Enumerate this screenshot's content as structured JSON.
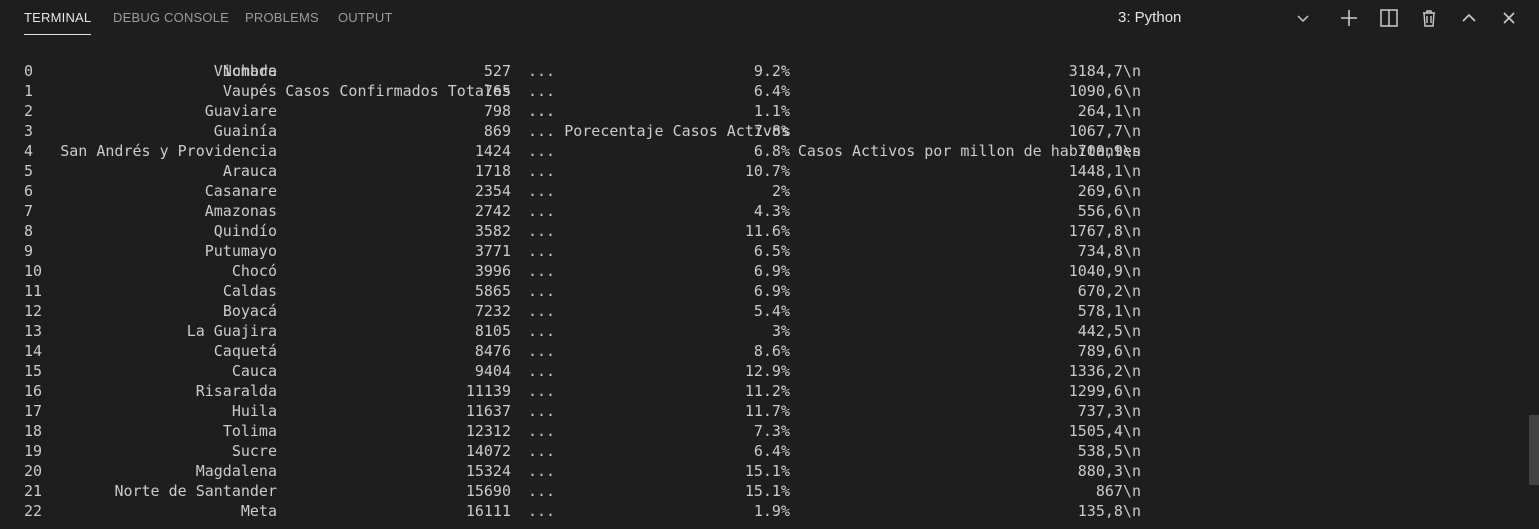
{
  "tabs": [
    {
      "label": "TERMINAL",
      "active": true
    },
    {
      "label": "DEBUG CONSOLE",
      "active": false
    },
    {
      "label": "PROBLEMS",
      "active": false
    },
    {
      "label": "OUTPUT",
      "active": false
    }
  ],
  "terminal_select": {
    "value": "3: Python"
  },
  "toolbar_icons": [
    "chevron-down-icon",
    "add-icon",
    "split-icon",
    "trash-icon",
    "chevron-up-icon",
    "close-icon"
  ],
  "table": {
    "headers": {
      "name": "Nombre",
      "confirmed": "Casos Confirmados Totales",
      "ellipsis": "...",
      "pct_active": "Porecentaje Casos Activos",
      "active_per_million": "Casos Activos por millon de habitantes"
    },
    "rows": [
      {
        "idx": "0",
        "name": "Vichada",
        "confirmed": "527",
        "ellipsis": "...",
        "pct": "9.2%",
        "apm": "3184,7\\n"
      },
      {
        "idx": "1",
        "name": "Vaupés",
        "confirmed": "765",
        "ellipsis": "...",
        "pct": "6.4%",
        "apm": "1090,6\\n"
      },
      {
        "idx": "2",
        "name": "Guaviare",
        "confirmed": "798",
        "ellipsis": "...",
        "pct": "1.1%",
        "apm": "264,1\\n"
      },
      {
        "idx": "3",
        "name": "Guainía",
        "confirmed": "869",
        "ellipsis": "...",
        "pct": "7.8%",
        "apm": "1067,7\\n"
      },
      {
        "idx": "4",
        "name": "San Andrés y Providencia",
        "confirmed": "1424",
        "ellipsis": "...",
        "pct": "6.8%",
        "apm": "700,9\\n"
      },
      {
        "idx": "5",
        "name": "Arauca",
        "confirmed": "1718",
        "ellipsis": "...",
        "pct": "10.7%",
        "apm": "1448,1\\n"
      },
      {
        "idx": "6",
        "name": "Casanare",
        "confirmed": "2354",
        "ellipsis": "...",
        "pct": "2%",
        "apm": "269,6\\n"
      },
      {
        "idx": "7",
        "name": "Amazonas",
        "confirmed": "2742",
        "ellipsis": "...",
        "pct": "4.3%",
        "apm": "556,6\\n"
      },
      {
        "idx": "8",
        "name": "Quindío",
        "confirmed": "3582",
        "ellipsis": "...",
        "pct": "11.6%",
        "apm": "1767,8\\n"
      },
      {
        "idx": "9",
        "name": "Putumayo",
        "confirmed": "3771",
        "ellipsis": "...",
        "pct": "6.5%",
        "apm": "734,8\\n"
      },
      {
        "idx": "10",
        "name": "Chocó",
        "confirmed": "3996",
        "ellipsis": "...",
        "pct": "6.9%",
        "apm": "1040,9\\n"
      },
      {
        "idx": "11",
        "name": "Caldas",
        "confirmed": "5865",
        "ellipsis": "...",
        "pct": "6.9%",
        "apm": "670,2\\n"
      },
      {
        "idx": "12",
        "name": "Boyacá",
        "confirmed": "7232",
        "ellipsis": "...",
        "pct": "5.4%",
        "apm": "578,1\\n"
      },
      {
        "idx": "13",
        "name": "La Guajira",
        "confirmed": "8105",
        "ellipsis": "...",
        "pct": "3%",
        "apm": "442,5\\n"
      },
      {
        "idx": "14",
        "name": "Caquetá",
        "confirmed": "8476",
        "ellipsis": "...",
        "pct": "8.6%",
        "apm": "789,6\\n"
      },
      {
        "idx": "15",
        "name": "Cauca",
        "confirmed": "9404",
        "ellipsis": "...",
        "pct": "12.9%",
        "apm": "1336,2\\n"
      },
      {
        "idx": "16",
        "name": "Risaralda",
        "confirmed": "11139",
        "ellipsis": "...",
        "pct": "11.2%",
        "apm": "1299,6\\n"
      },
      {
        "idx": "17",
        "name": "Huila",
        "confirmed": "11637",
        "ellipsis": "...",
        "pct": "11.7%",
        "apm": "737,3\\n"
      },
      {
        "idx": "18",
        "name": "Tolima",
        "confirmed": "12312",
        "ellipsis": "...",
        "pct": "7.3%",
        "apm": "1505,4\\n"
      },
      {
        "idx": "19",
        "name": "Sucre",
        "confirmed": "14072",
        "ellipsis": "...",
        "pct": "6.4%",
        "apm": "538,5\\n"
      },
      {
        "idx": "20",
        "name": "Magdalena",
        "confirmed": "15324",
        "ellipsis": "...",
        "pct": "15.1%",
        "apm": "880,3\\n"
      },
      {
        "idx": "21",
        "name": "Norte de Santander",
        "confirmed": "15690",
        "ellipsis": "...",
        "pct": "15.1%",
        "apm": "867\\n"
      },
      {
        "idx": "22",
        "name": "Meta",
        "confirmed": "16111",
        "ellipsis": "...",
        "pct": "1.9%",
        "apm": "135,8\\n"
      }
    ]
  },
  "colors": {
    "background": "#1e1e1e",
    "text": "#cccccc",
    "tab_inactive": "#9d9d9d",
    "tab_active": "#e7e7e7",
    "scrollbar": "#424242"
  }
}
